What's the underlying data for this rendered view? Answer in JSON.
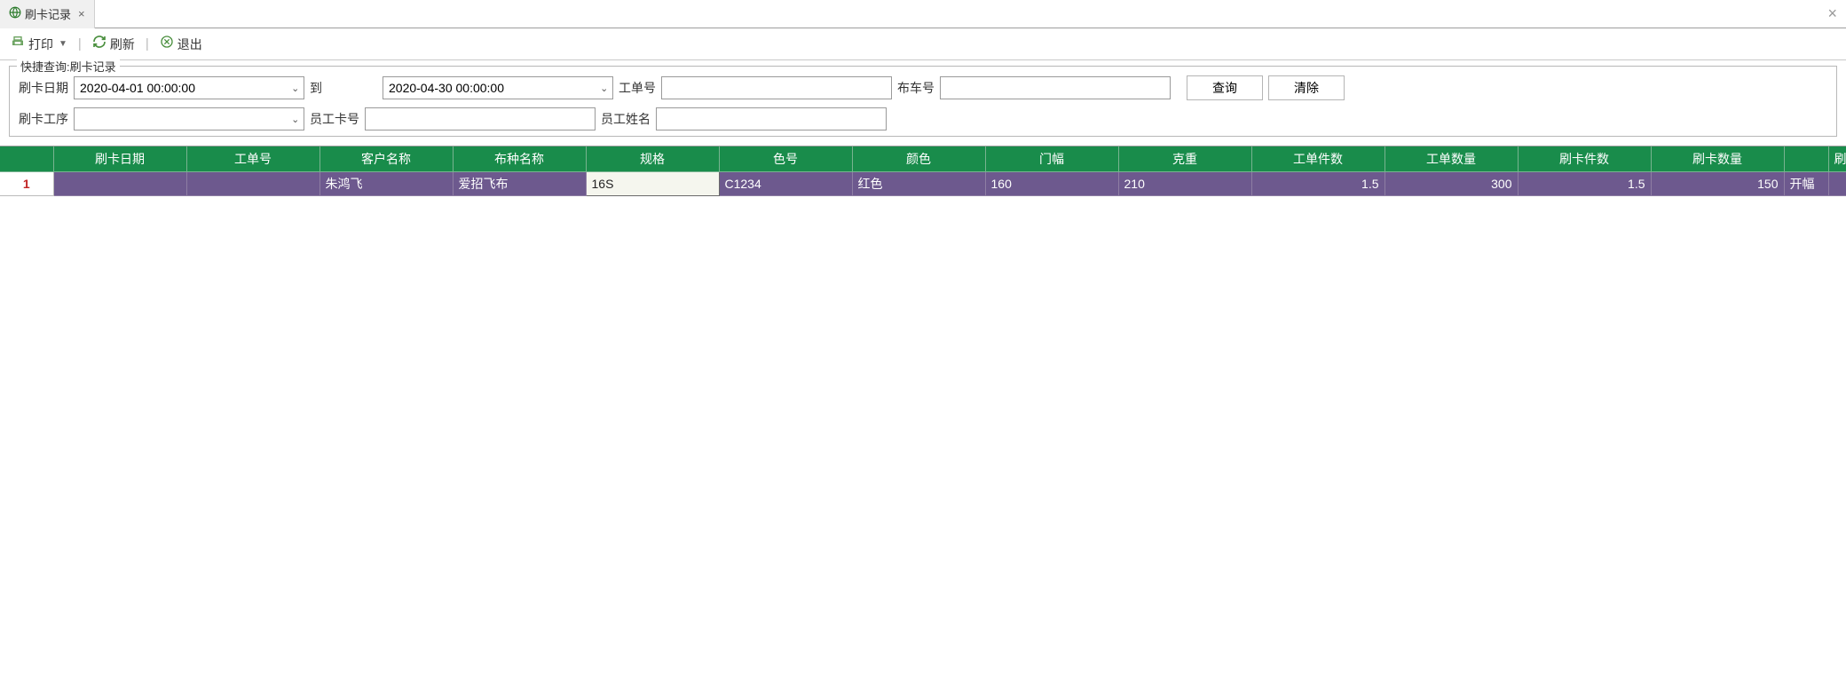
{
  "tab": {
    "title": "刷卡记录"
  },
  "toolbar": {
    "print_label": "打印",
    "refresh_label": "刷新",
    "exit_label": "退出"
  },
  "filter": {
    "legend": "快捷查询:刷卡记录",
    "labels": {
      "card_date": "刷卡日期",
      "to": "到",
      "work_order": "工单号",
      "cloth_cart": "布车号",
      "card_process": "刷卡工序",
      "emp_card": "员工卡号",
      "emp_name": "员工姓名"
    },
    "values": {
      "date_from": "2020-04-01 00:00:00",
      "date_to": "2020-04-30 00:00:00",
      "work_order": "",
      "cloth_cart": "",
      "card_process": "",
      "emp_card": "",
      "emp_name": ""
    },
    "buttons": {
      "query": "查询",
      "clear": "清除"
    }
  },
  "grid": {
    "headers": [
      "刷卡日期",
      "工单号",
      "客户名称",
      "布种名称",
      "规格",
      "色号",
      "颜色",
      "门幅",
      "克重",
      "工单件数",
      "工单数量",
      "刷卡件数",
      "刷卡数量",
      ""
    ],
    "last_partial_header": "刷",
    "rows": [
      {
        "n": "1",
        "card_date": "",
        "work_order": "",
        "customer": "朱鸿飞",
        "cloth_type": "爱招飞布",
        "spec": "16S",
        "color_no": "C1234",
        "color": "红色",
        "width": "160",
        "weight": "210",
        "wo_pcs": "1.5",
        "wo_qty": "300",
        "card_pcs": "1.5",
        "card_qty": "150",
        "extra": "开幅"
      }
    ]
  }
}
